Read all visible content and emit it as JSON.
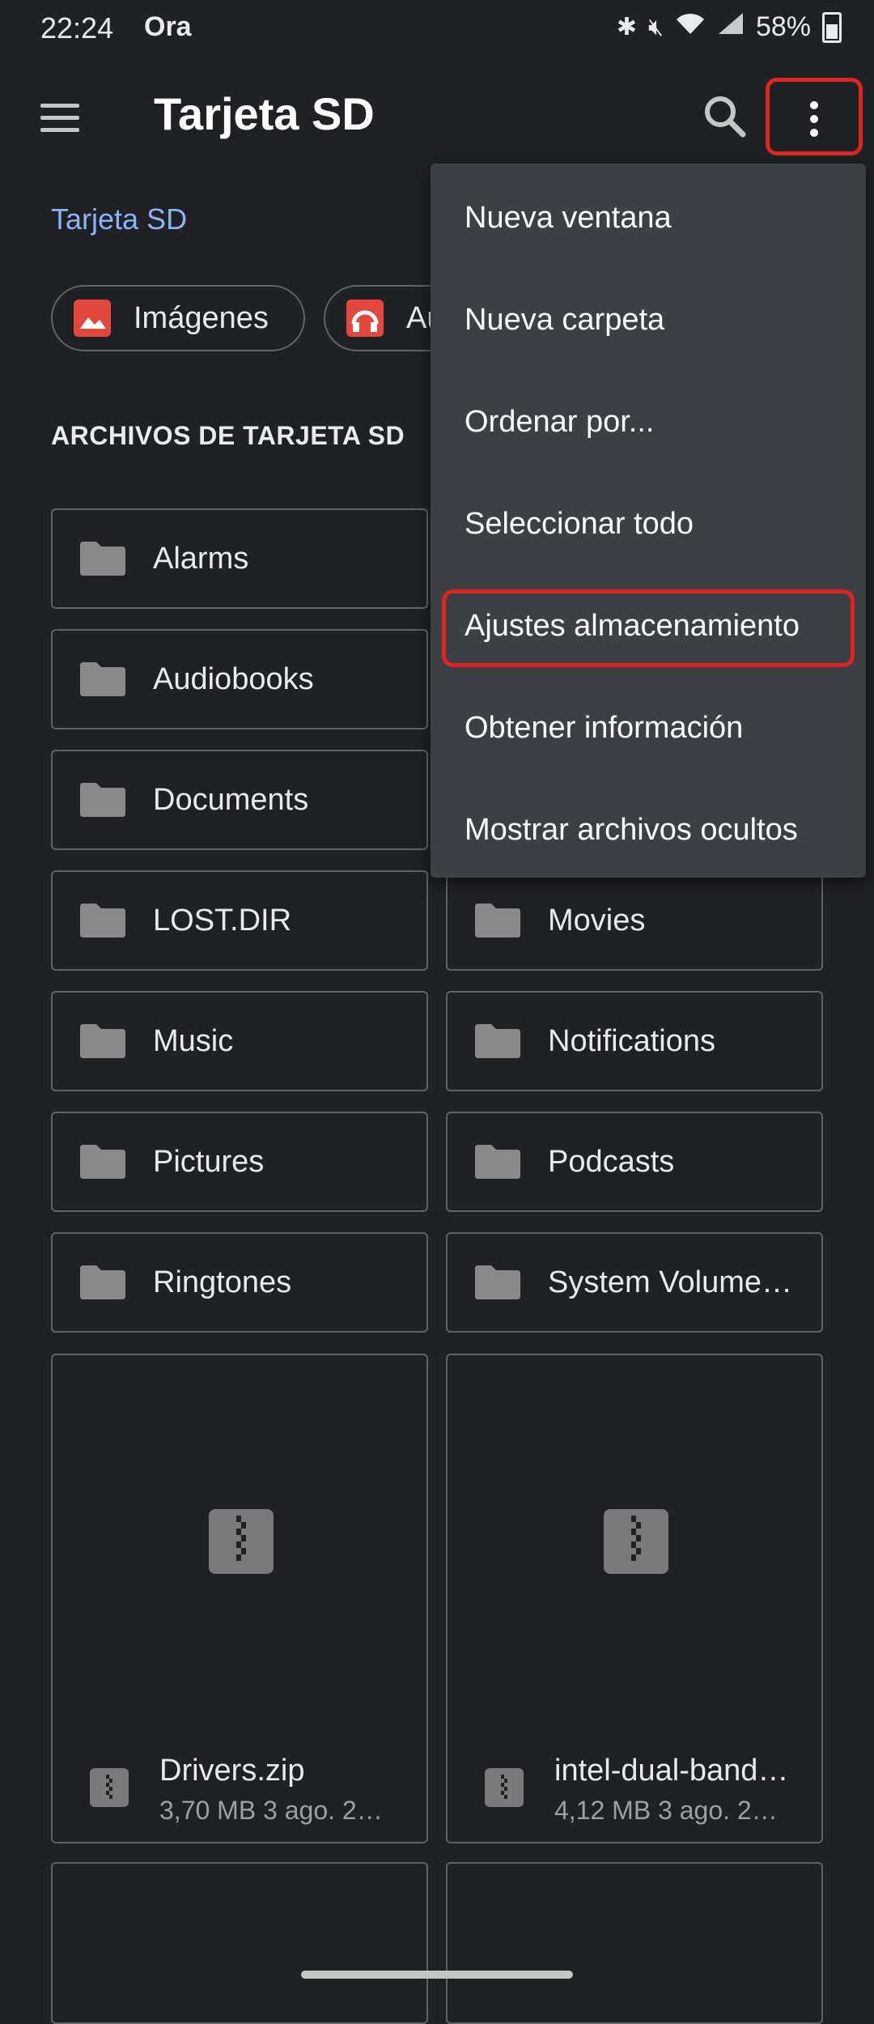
{
  "status_bar": {
    "time": "22:24",
    "carrier": "Ora",
    "battery": "58%"
  },
  "app_bar": {
    "title": "Tarjeta SD"
  },
  "breadcrumb": "Tarjeta SD",
  "chips": [
    {
      "label": "Imágenes",
      "icon": "image-icon"
    },
    {
      "label": "Audio",
      "icon": "headphones-icon"
    }
  ],
  "section_header": "ARCHIVOS DE TARJETA SD",
  "folders_left": [
    "Alarms",
    "Audiobooks",
    "Documents",
    "LOST.DIR",
    "Music",
    "Pictures",
    "Ringtones"
  ],
  "folders_right": [
    "Movies",
    "Notifications",
    "Podcasts",
    "System Volume…"
  ],
  "files": [
    {
      "name": "Drivers.zip",
      "meta": "3,70 MB 3 ago. 2…"
    },
    {
      "name": "intel-dual-band…",
      "meta": "4,12 MB 3 ago. 2…"
    }
  ],
  "menu": {
    "items": [
      "Nueva ventana",
      "Nueva carpeta",
      "Ordenar por...",
      "Seleccionar todo",
      "Ajustes almacenamiento",
      "Obtener información",
      "Mostrar archivos ocultos"
    ],
    "highlighted_index": 4
  },
  "colors": {
    "background": "#202124",
    "accent_link": "#8ab4f8",
    "menu_background": "#3c3f43",
    "highlight_red": "#e02424",
    "chip_icon_red": "#e2483d"
  }
}
